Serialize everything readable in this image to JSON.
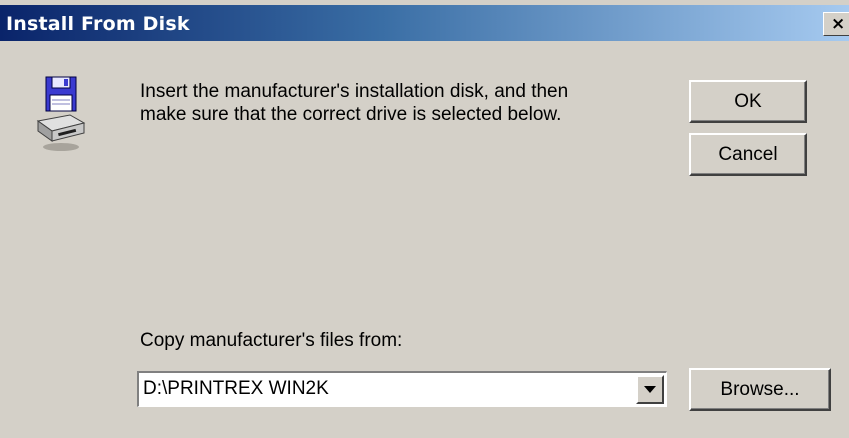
{
  "window": {
    "title": "Install From Disk",
    "close_glyph": "×"
  },
  "icons": {
    "disk": "floppy-disk-drive-icon",
    "dropdown": "chevron-down-icon"
  },
  "message": {
    "line1": "Insert the manufacturer's installation disk, and then",
    "line2": "make sure that the correct drive is selected below."
  },
  "buttons": {
    "ok": "OK",
    "cancel": "Cancel",
    "browse": "Browse..."
  },
  "copy_from": {
    "label": "Copy manufacturer's files from:",
    "value": "D:\\PRINTREX WIN2K"
  },
  "colors": {
    "dialog_background": "#d4d0c8",
    "titlebar_start": "#0a246a",
    "titlebar_end": "#a6caf0"
  }
}
